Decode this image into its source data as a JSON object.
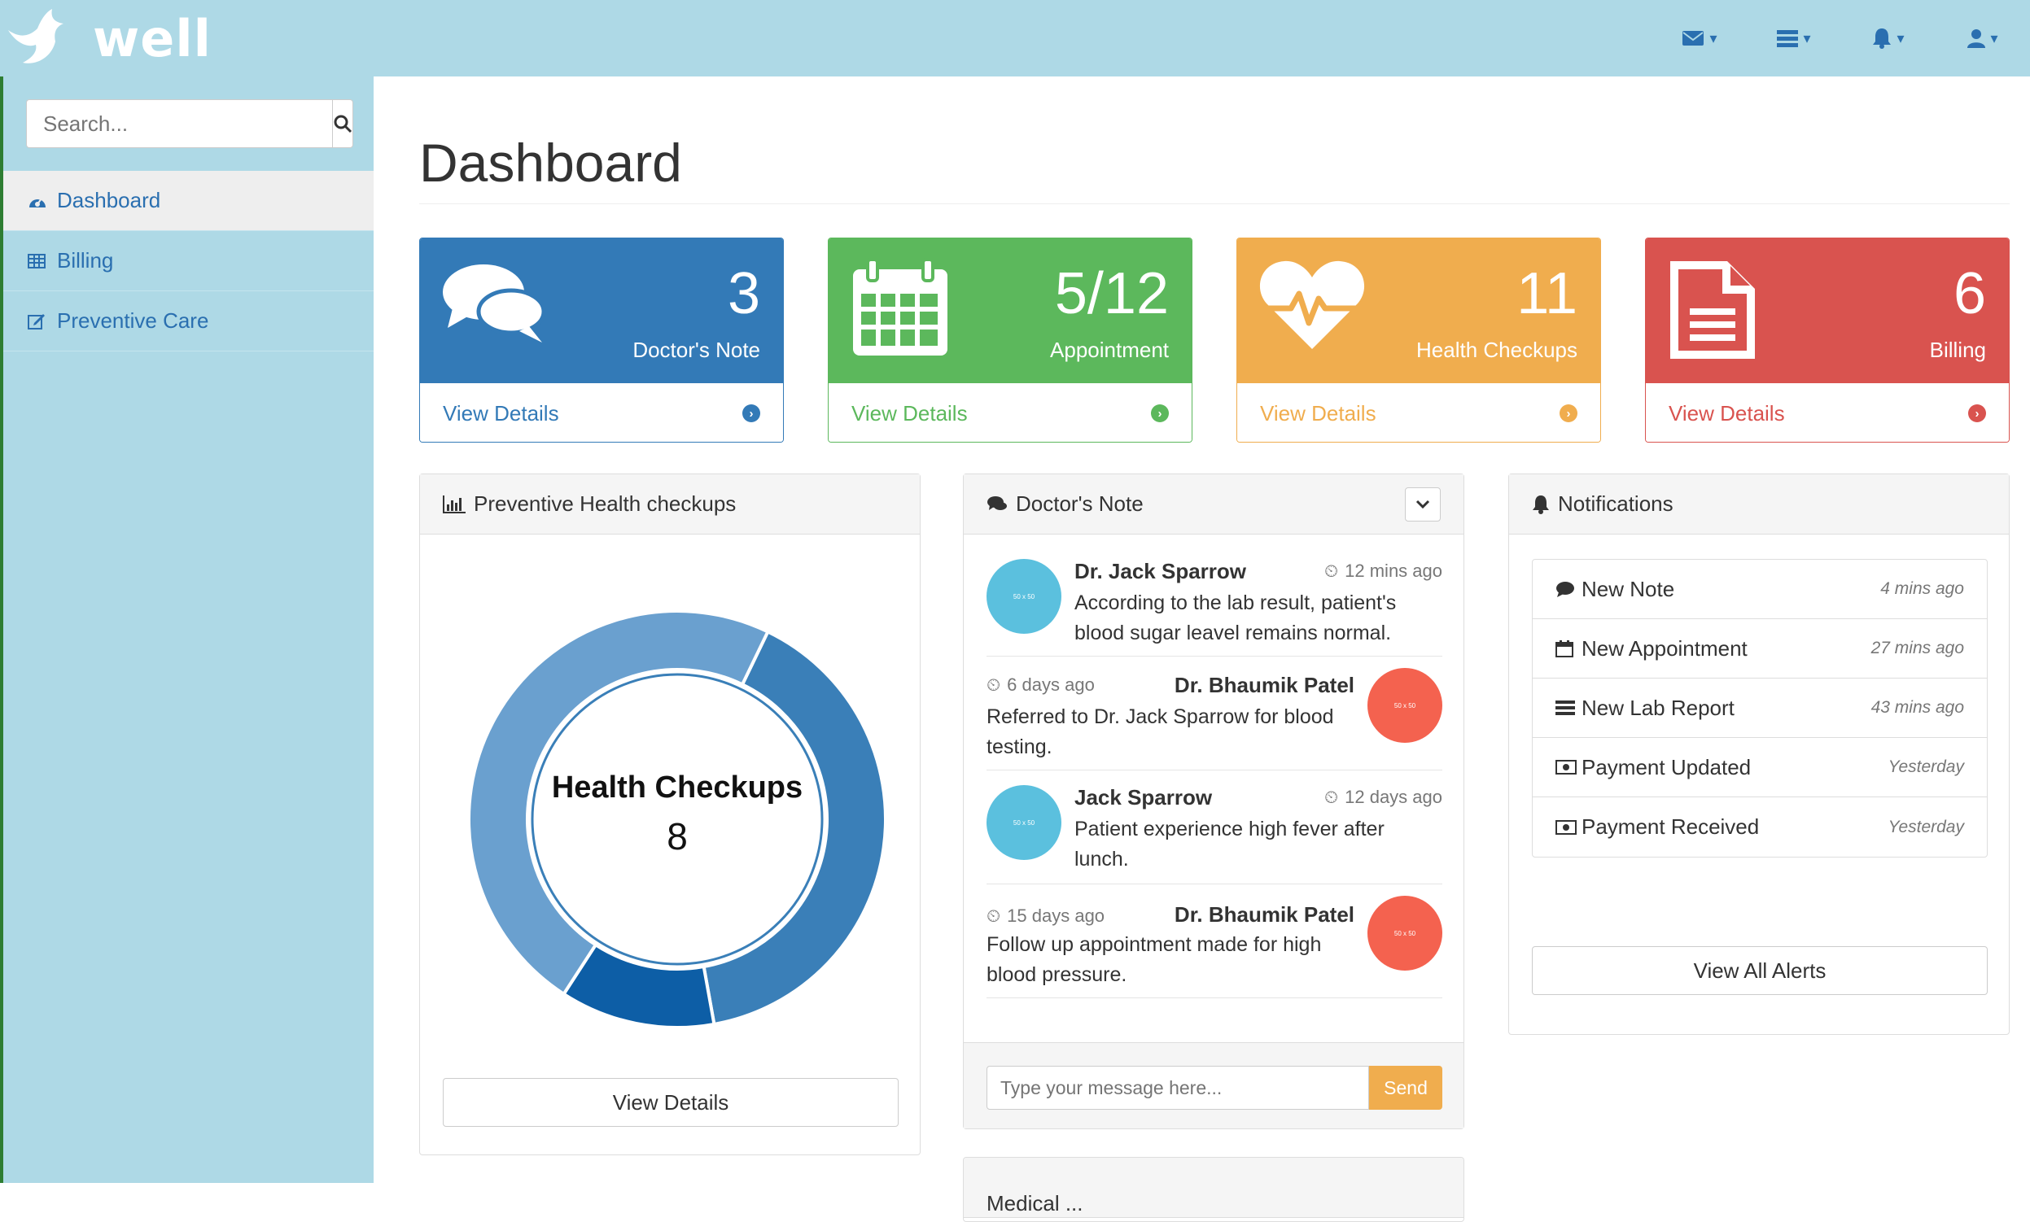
{
  "brand": {
    "name": "well"
  },
  "topnav": {
    "items": [
      "envelope-icon",
      "tasks-icon",
      "bell-icon",
      "user-icon"
    ]
  },
  "search": {
    "placeholder": "Search..."
  },
  "sidebar": {
    "items": [
      {
        "label": "Dashboard",
        "icon": "dashboard-icon",
        "active": true
      },
      {
        "label": "Billing",
        "icon": "table-icon"
      },
      {
        "label": "Preventive Care",
        "icon": "edit-icon"
      }
    ]
  },
  "page": {
    "title": "Dashboard"
  },
  "cards": [
    {
      "count": "3",
      "label": "Doctor's Note",
      "link": "View Details",
      "color": "#337ab7",
      "icon": "comments-icon"
    },
    {
      "count": "5/12",
      "label": "Appointment",
      "link": "View Details",
      "color": "#5cb85c",
      "icon": "calendar-icon"
    },
    {
      "count": "11",
      "label": "Health Checkups",
      "link": "View Details",
      "color": "#f0ad4e",
      "icon": "heartbeat-icon"
    },
    {
      "count": "6",
      "label": "Billing",
      "link": "View Details",
      "color": "#d9534f",
      "icon": "file-text-icon"
    }
  ],
  "checkups_panel": {
    "title": "Preventive Health checkups",
    "center_label": "Health Checkups",
    "center_value": "8",
    "button": "View Details"
  },
  "chart_data": {
    "type": "pie",
    "title": "Health Checkups",
    "values": [
      40,
      12,
      48
    ],
    "colors": [
      "#3a7fb8",
      "#0d5ea6",
      "#6aa0cf"
    ]
  },
  "doctor_note_panel": {
    "title": "Doctor's Note",
    "messages": [
      {
        "name": "Dr. Jack Sparrow",
        "time": "12 mins ago",
        "text_lines": [
          "According to the lab result, patient's",
          "blood sugar leavel remains normal."
        ],
        "avatar": "50 x 50",
        "side": "left"
      },
      {
        "name": "Dr. Bhaumik Patel",
        "time": "6 days ago",
        "text_lines": [
          "Referred to Dr. Jack Sparrow for blood",
          "testing."
        ],
        "avatar": "50 x 50",
        "side": "right"
      },
      {
        "name": "Jack Sparrow",
        "time": "12 days ago",
        "text_lines": [
          "Patient experience high fever after",
          "lunch."
        ],
        "avatar": "50 x 50",
        "side": "left"
      },
      {
        "name": "Dr. Bhaumik Patel",
        "time": "15 days ago",
        "text_lines": [
          "Follow up appointment made for high",
          "blood pressure."
        ],
        "avatar": "50 x 50",
        "side": "right"
      }
    ],
    "input_placeholder": "Type your message here...",
    "send_label": "Send"
  },
  "notifications_panel": {
    "title": "Notifications",
    "items": [
      {
        "label": "New Note",
        "time": "4 mins ago",
        "icon": "comment-icon"
      },
      {
        "label": "New Appointment",
        "time": "27 mins ago",
        "icon": "calendar-icon"
      },
      {
        "label": "New Lab Report",
        "time": "43 mins ago",
        "icon": "tasks-icon"
      },
      {
        "label": "Payment Updated",
        "time": "Yesterday",
        "icon": "money-icon"
      },
      {
        "label": "Payment Received",
        "time": "Yesterday",
        "icon": "money-icon"
      }
    ],
    "button": "View All Alerts"
  },
  "bottom_panel": {
    "title": "Medical ..."
  }
}
